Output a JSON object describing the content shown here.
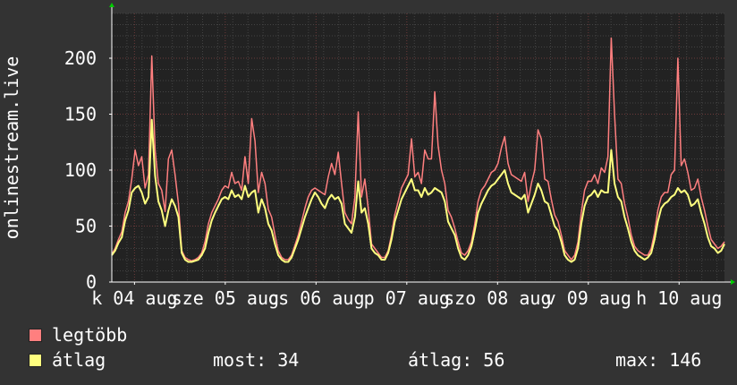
{
  "chart_data": {
    "type": "area",
    "ylabel": "onlinestream.live",
    "ylim": [
      0,
      240
    ],
    "yticks": [
      0,
      50,
      100,
      150,
      200
    ],
    "xlabels": [
      "k 04 aug",
      "sze 05 aug",
      "cs 06 aug",
      "p 07 aug",
      "szo 08 aug",
      "v 09 aug",
      "h 10 aug"
    ],
    "grid": true,
    "colors": {
      "background": "#333333",
      "plot": "#222222",
      "grid_major": "#6b3a3a",
      "grid_minor": "#444444",
      "max_series": "#ff7f7f",
      "avg_series": "#ffff7f"
    },
    "series": [
      {
        "name": "legtöbb",
        "color": "#ff7f7f",
        "values": [
          25,
          30,
          38,
          45,
          62,
          72,
          92,
          118,
          104,
          112,
          84,
          96,
          202,
          118,
          88,
          82,
          63,
          110,
          118,
          96,
          70,
          28,
          22,
          20,
          19,
          20,
          22,
          26,
          36,
          52,
          62,
          68,
          74,
          82,
          86,
          84,
          98,
          88,
          90,
          82,
          112,
          88,
          146,
          126,
          80,
          98,
          88,
          65,
          58,
          42,
          28,
          22,
          20,
          20,
          24,
          33,
          42,
          54,
          66,
          76,
          82,
          84,
          82,
          80,
          78,
          94,
          106,
          96,
          116,
          88,
          62,
          56,
          52,
          76,
          152,
          76,
          92,
          66,
          34,
          30,
          26,
          22,
          22,
          28,
          42,
          60,
          72,
          84,
          90,
          96,
          128,
          94,
          98,
          88,
          118,
          110,
          110,
          170,
          122,
          100,
          88,
          64,
          58,
          48,
          36,
          26,
          24,
          28,
          36,
          52,
          72,
          82,
          86,
          92,
          98,
          100,
          106,
          120,
          130,
          106,
          96,
          94,
          92,
          90,
          98,
          72,
          88,
          100,
          136,
          128,
          92,
          90,
          74,
          60,
          54,
          42,
          28,
          24,
          20,
          24,
          36,
          62,
          82,
          90,
          90,
          96,
          88,
          102,
          98,
          112,
          218,
          150,
          92,
          88,
          70,
          58,
          42,
          32,
          28,
          26,
          24,
          24,
          30,
          44,
          64,
          76,
          80,
          80,
          96,
          100,
          200,
          104,
          110,
          98,
          82,
          84,
          92,
          76,
          64,
          50,
          38,
          34,
          30,
          32,
          36
        ]
      },
      {
        "name": "átlag",
        "color": "#ffff7f",
        "values": [
          24,
          28,
          35,
          40,
          55,
          64,
          80,
          84,
          86,
          80,
          70,
          76,
          145,
          95,
          72,
          64,
          50,
          64,
          74,
          68,
          58,
          26,
          20,
          18,
          18,
          19,
          20,
          24,
          30,
          44,
          55,
          62,
          68,
          74,
          76,
          74,
          82,
          76,
          78,
          74,
          86,
          76,
          80,
          82,
          62,
          74,
          66,
          52,
          46,
          34,
          24,
          20,
          18,
          18,
          22,
          30,
          38,
          48,
          58,
          66,
          74,
          80,
          76,
          70,
          66,
          74,
          78,
          74,
          76,
          70,
          52,
          48,
          44,
          58,
          90,
          62,
          66,
          52,
          30,
          26,
          24,
          20,
          20,
          26,
          38,
          54,
          64,
          74,
          80,
          86,
          92,
          82,
          82,
          76,
          84,
          78,
          80,
          84,
          82,
          80,
          72,
          54,
          48,
          42,
          30,
          22,
          20,
          24,
          32,
          46,
          62,
          70,
          76,
          82,
          86,
          88,
          92,
          96,
          100,
          88,
          80,
          78,
          76,
          74,
          78,
          62,
          70,
          78,
          88,
          82,
          72,
          70,
          60,
          50,
          46,
          36,
          24,
          20,
          18,
          20,
          30,
          52,
          68,
          76,
          78,
          82,
          76,
          82,
          80,
          80,
          118,
          88,
          76,
          72,
          58,
          48,
          36,
          28,
          24,
          22,
          20,
          22,
          26,
          38,
          54,
          66,
          70,
          72,
          76,
          78,
          84,
          80,
          82,
          78,
          68,
          70,
          74,
          62,
          52,
          40,
          32,
          30,
          26,
          28,
          34
        ]
      }
    ]
  },
  "legend": [
    {
      "label": "legtöbb",
      "color": "#ff7f7f"
    },
    {
      "label": "átlag",
      "color": "#ffff7f"
    }
  ],
  "stats": {
    "most": "most: 34",
    "atlag": "átlag: 56",
    "max": "max: 146"
  }
}
